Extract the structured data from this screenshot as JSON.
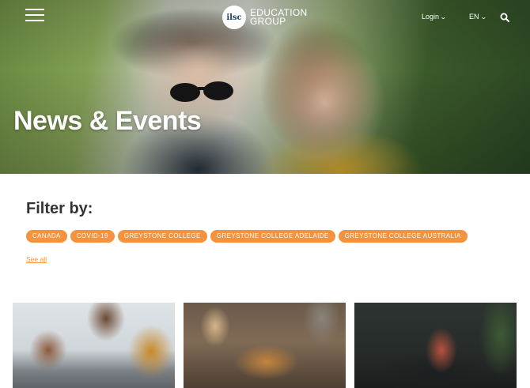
{
  "header": {
    "menu_icon": "hamburger-menu-icon",
    "logo_mark": "ilsc",
    "logo_line1": "EDUCATION",
    "logo_line2": "GROUP",
    "login_label": "Login",
    "lang_label": "EN",
    "search_icon": "search-icon",
    "chevron_icon": "chevron-down-icon"
  },
  "hero": {
    "title": "News & Events"
  },
  "filter": {
    "heading": "Filter by:",
    "chips": [
      "CANADA",
      "COVID-19",
      "GREYSTONE COLLEGE",
      "GREYSTONE COLLEGE ADELAIDE",
      "GREYSTONE COLLEGE AUSTRALIA"
    ],
    "see_all": "See all"
  },
  "colors": {
    "accent": "#f5923e",
    "heading": "#333333"
  }
}
